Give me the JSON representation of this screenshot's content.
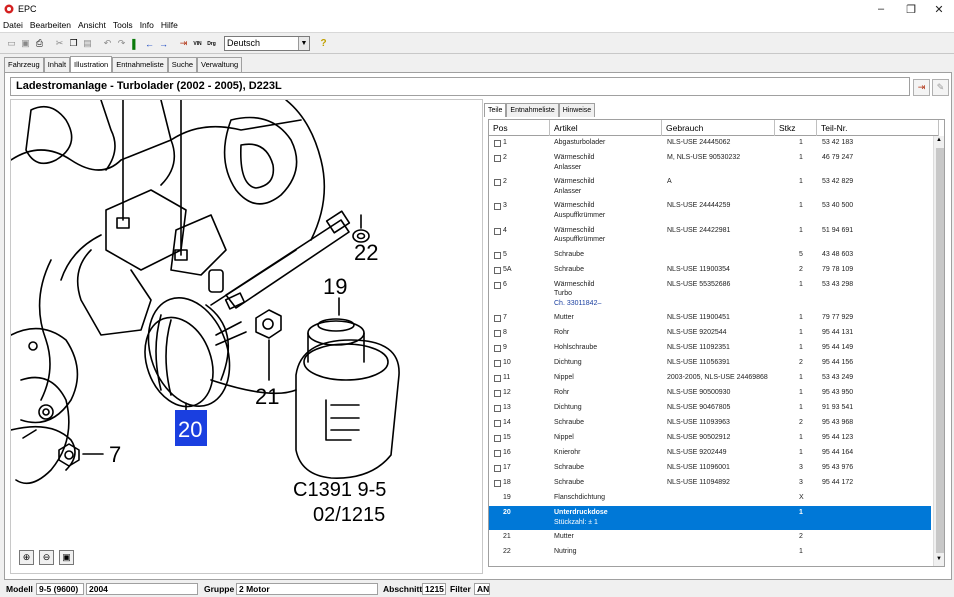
{
  "window": {
    "title": "EPC",
    "min": "–",
    "restore": "❐",
    "close": "✕"
  },
  "menu": [
    "Datei",
    "Bearbeiten",
    "Ansicht",
    "Tools",
    "Info",
    "Hilfe"
  ],
  "toolbar": {
    "language": "Deutsch",
    "vin_label": "VIN",
    "drg_label": "Drg"
  },
  "main_tabs": [
    "Fahrzeug",
    "Inhalt",
    "Illustration",
    "Entnahmeliste",
    "Suche",
    "Verwaltung"
  ],
  "active_main_tab": "Illustration",
  "header": {
    "title": "Ladestromanlage - Turbolader   (2002 - 2005), D223L"
  },
  "illustration": {
    "callouts": [
      "22",
      "19",
      "21",
      "7",
      "20"
    ],
    "selected_callout": "20",
    "code_line1": "C1391 9-5",
    "code_line2": "02/1215"
  },
  "sub_tabs": [
    "Teile",
    "Entnahmeliste",
    "Hinweise"
  ],
  "columns": [
    "Pos",
    "Artikel",
    "Gebrauch",
    "Stkz",
    "Teil-Nr."
  ],
  "rows": [
    {
      "pos": "1",
      "artikel": "Abgasturbolader",
      "sub": "",
      "gebrauch": "NLS-USE 24445062",
      "stkz": "1",
      "teil": "53 42 183",
      "cb": true
    },
    {
      "pos": "2",
      "artikel": "Wärmeschild",
      "sub": "Anlasser",
      "gebrauch": "M, NLS-USE 90530232",
      "stkz": "1",
      "teil": "46 79 247",
      "cb": true
    },
    {
      "pos": "2",
      "artikel": "Wärmeschild",
      "sub": "Anlasser",
      "gebrauch": "A",
      "stkz": "1",
      "teil": "53 42 829",
      "cb": true
    },
    {
      "pos": "3",
      "artikel": "Wärmeschild",
      "sub": "Auspuffkrümmer",
      "gebrauch": "NLS-USE 24444259",
      "stkz": "1",
      "teil": "53 40 500",
      "cb": true
    },
    {
      "pos": "4",
      "artikel": "Wärmeschild",
      "sub": "Auspuffkrümmer",
      "gebrauch": "NLS-USE 24422981",
      "stkz": "1",
      "teil": "51 94 691",
      "cb": true
    },
    {
      "pos": "5",
      "artikel": "Schraube",
      "sub": "",
      "gebrauch": "",
      "stkz": "5",
      "teil": "43 48 603",
      "cb": true
    },
    {
      "pos": "5A",
      "artikel": "Schraube",
      "sub": "",
      "gebrauch": "NLS-USE 11900354",
      "stkz": "2",
      "teil": "79 78 109",
      "cb": true
    },
    {
      "pos": "6",
      "artikel": "Wärmeschild",
      "sub": "Turbo",
      "link": "Ch. 33011842–",
      "gebrauch": "NLS-USE 55352686",
      "stkz": "1",
      "teil": "53 43 298",
      "cb": true
    },
    {
      "pos": "7",
      "artikel": "Mutter",
      "sub": "",
      "gebrauch": "NLS-USE 11900451",
      "stkz": "1",
      "teil": "79 77 929",
      "cb": true
    },
    {
      "pos": "8",
      "artikel": "Rohr",
      "sub": "",
      "gebrauch": "NLS-USE 9202544",
      "stkz": "1",
      "teil": "95 44 131",
      "cb": true
    },
    {
      "pos": "9",
      "artikel": "Hohlschraube",
      "sub": "",
      "gebrauch": "NLS-USE 11092351",
      "stkz": "1",
      "teil": "95 44 149",
      "cb": true
    },
    {
      "pos": "10",
      "artikel": "Dichtung",
      "sub": "",
      "gebrauch": "NLS-USE 11056391",
      "stkz": "2",
      "teil": "95 44 156",
      "cb": true
    },
    {
      "pos": "11",
      "artikel": "Nippel",
      "sub": "",
      "gebrauch": "2003-2005, NLS-USE 24469868",
      "stkz": "1",
      "teil": "53 43 249",
      "cb": true
    },
    {
      "pos": "12",
      "artikel": "Rohr",
      "sub": "",
      "gebrauch": "NLS-USE 90500930",
      "stkz": "1",
      "teil": "95 43 950",
      "cb": true
    },
    {
      "pos": "13",
      "artikel": "Dichtung",
      "sub": "",
      "gebrauch": "NLS-USE 90467805",
      "stkz": "1",
      "teil": "91 93 541",
      "cb": true
    },
    {
      "pos": "14",
      "artikel": "Schraube",
      "sub": "",
      "gebrauch": "NLS-USE 11093963",
      "stkz": "2",
      "teil": "95 43 968",
      "cb": true
    },
    {
      "pos": "15",
      "artikel": "Nippel",
      "sub": "",
      "gebrauch": "NLS-USE 90502912",
      "stkz": "1",
      "teil": "95 44 123",
      "cb": true
    },
    {
      "pos": "16",
      "artikel": "Knierohr",
      "sub": "",
      "gebrauch": "NLS-USE 9202449",
      "stkz": "1",
      "teil": "95 44 164",
      "cb": true
    },
    {
      "pos": "17",
      "artikel": "Schraube",
      "sub": "",
      "gebrauch": "NLS-USE 11096001",
      "stkz": "3",
      "teil": "95 43 976",
      "cb": true
    },
    {
      "pos": "18",
      "artikel": "Schraube",
      "sub": "",
      "gebrauch": "NLS-USE 11094892",
      "stkz": "3",
      "teil": "95 44 172",
      "cb": true
    },
    {
      "pos": "19",
      "artikel": "Flanschdichtung",
      "sub": "",
      "gebrauch": "",
      "stkz": "X",
      "teil": "",
      "cb": false
    },
    {
      "pos": "20",
      "artikel": "Unterdruckdose",
      "sub": "Stückzahl: ± 1",
      "gebrauch": "",
      "stkz": "1",
      "teil": "",
      "cb": false,
      "selected": true
    },
    {
      "pos": "21",
      "artikel": "Mutter",
      "sub": "",
      "gebrauch": "",
      "stkz": "2",
      "teil": "",
      "cb": false
    },
    {
      "pos": "22",
      "artikel": "Nutring",
      "sub": "",
      "gebrauch": "",
      "stkz": "1",
      "teil": "",
      "cb": false
    }
  ],
  "status": {
    "modell_label": "Modell",
    "modell_value": "9-5 (9600)",
    "year_value": "2004",
    "gruppe_label": "Gruppe",
    "gruppe_value": "2 Motor",
    "abschnitt_label": "Abschnitt",
    "abschnitt_value": "1215",
    "filter_label": "Filter",
    "filter_value": "AN"
  }
}
